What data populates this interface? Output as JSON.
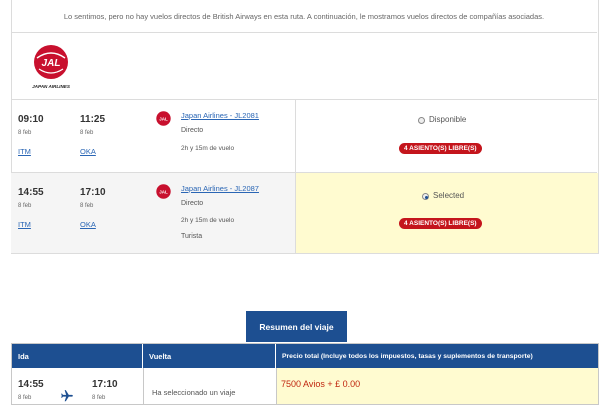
{
  "notice": "Lo sentimos, pero no hay vuelos directos de British Airways en esta ruta. A continuación, le mostramos vuelos directos de compañías asociadas.",
  "airline_logo": {
    "mark": "JAL",
    "name": "JAPAN AIRLINES"
  },
  "flights": [
    {
      "depart_time": "09:10",
      "depart_date": "8 feb",
      "depart_code": "ITM",
      "arrive_time": "11:25",
      "arrive_date": "8 feb",
      "arrive_code": "OKA",
      "flight": "Japan Airlines - JL2081",
      "type": "Directo",
      "duration": "2h y 15m de vuelo",
      "cabin": "",
      "availability": "Disponible",
      "seats": "4 ASIENTO(S) LIBRE(S)",
      "selected": false
    },
    {
      "depart_time": "14:55",
      "depart_date": "8 feb",
      "depart_code": "ITM",
      "arrive_time": "17:10",
      "arrive_date": "8 feb",
      "arrive_code": "OKA",
      "flight": "Japan Airlines - JL2087",
      "type": "Directo",
      "duration": "2h y 15m de vuelo",
      "cabin": "Turista",
      "availability": "Selected",
      "seats": "4 ASIENTO(S) LIBRE(S)",
      "selected": true
    }
  ],
  "summary": {
    "tab": "Resumen del viaje",
    "col_ida": "Ida",
    "col_vuelta": "Vuelta",
    "col_total": "Precio total (Incluye todos los impuestos, tasas y suplementos de transporte)",
    "ida_depart_time": "14:55",
    "ida_depart_date": "8 feb",
    "ida_arrive_time": "17:10",
    "ida_arrive_date": "8 feb",
    "vuelta_text": "Ha seleccionado un viaje",
    "total": "7500 Avios + £ 0.00"
  },
  "colors": {
    "brand_blue": "#1d4f91",
    "badge_red": "#c4151c",
    "selected_bg": "#fffbd0",
    "jal_red": "#c8102e"
  }
}
